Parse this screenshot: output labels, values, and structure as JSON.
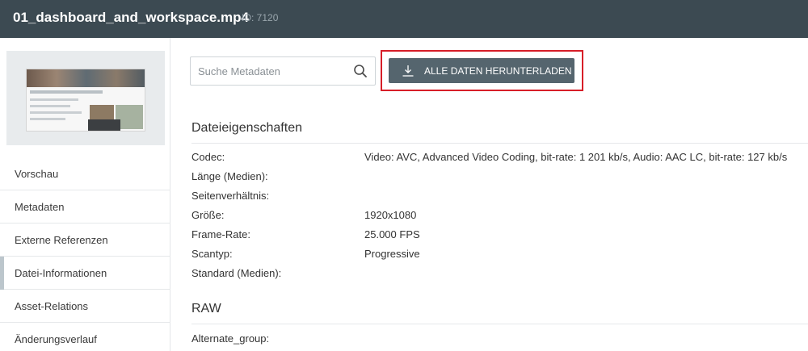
{
  "header": {
    "title": "01_dashboard_and_workspace.mp4",
    "id_label": "ID: 7120"
  },
  "sidebar": {
    "items": [
      {
        "label": "Vorschau",
        "active": false
      },
      {
        "label": "Metadaten",
        "active": false
      },
      {
        "label": "Externe Referenzen",
        "active": false
      },
      {
        "label": "Datei-Informationen",
        "active": true
      },
      {
        "label": "Asset-Relations",
        "active": false
      },
      {
        "label": "Änderungsverlauf",
        "active": false
      }
    ]
  },
  "search": {
    "placeholder": "Suche Metadaten",
    "value": ""
  },
  "toolbar": {
    "download_label": "ALLE DATEN HERUNTERLADEN"
  },
  "sections": {
    "file_properties": {
      "title": "Dateieigenschaften",
      "rows": [
        {
          "key": "Codec:",
          "value": "Video: AVC, Advanced Video Coding, bit-rate: 1 201 kb/s, Audio: AAC LC, bit-rate: 127 kb/s"
        },
        {
          "key": "Länge (Medien):",
          "value": ""
        },
        {
          "key": "Seitenverhältnis:",
          "value": ""
        },
        {
          "key": "Größe:",
          "value": "1920x1080"
        },
        {
          "key": "Frame-Rate:",
          "value": "25.000 FPS"
        },
        {
          "key": "Scantyp:",
          "value": "Progressive"
        },
        {
          "key": "Standard (Medien):",
          "value": ""
        }
      ]
    },
    "raw": {
      "title": "RAW",
      "rows": [
        {
          "key": "Alternate_group:",
          "value": ""
        }
      ]
    }
  },
  "colors": {
    "header_bg": "#3c4a52",
    "button_bg": "#55656e",
    "highlight": "#d71e28"
  }
}
